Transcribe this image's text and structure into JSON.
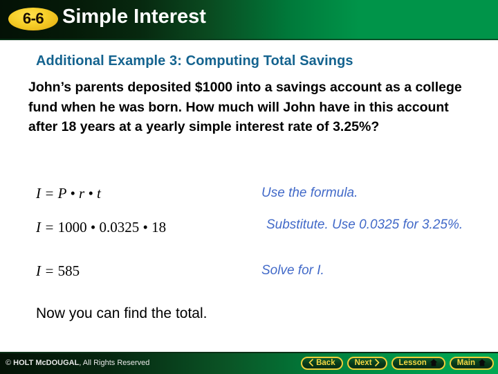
{
  "header": {
    "lesson_number": "6-6",
    "title": "Simple Interest",
    "background_left_color": "#041106",
    "background_right_color": "#009449",
    "badge_color": "#f7cf2a",
    "title_color": "#ffffff"
  },
  "slide": {
    "example_heading": "Additional Example 3: Computing Total Savings",
    "example_heading_color": "#14638f",
    "problem_text": "John’s parents deposited $1000 into a savings account as a college fund when he was born. How much will John have in this account after 18 years at a yearly simple interest rate of 3.25%?",
    "closing_text": "Now you can find the total.",
    "annotation_color": "#4169c8",
    "work_rows": [
      {
        "equation": "I = P • r • t",
        "annotation": "Use the formula."
      },
      {
        "equation_prefix": "I = ",
        "equation_numbers": "1000 • 0.0325 • 18",
        "annotation": "Substitute. Use 0.0325 for 3.25%."
      },
      {
        "equation_prefix": "I = ",
        "equation_numbers": "585",
        "annotation": "Solve for I."
      }
    ]
  },
  "footer": {
    "copyright_symbol": "© ",
    "copyright_brand": "HOLT McDOUGAL",
    "copyright_rest": ", All Rights Reserved",
    "buttons": [
      {
        "label": "Back",
        "icon": "chevron-left-icon"
      },
      {
        "label": "Next",
        "icon": "chevron-right-icon"
      },
      {
        "label": "Lesson",
        "icon": "home-icon"
      },
      {
        "label": "Main",
        "icon": "home-icon"
      }
    ],
    "button_border_color": "#f0cf3a",
    "button_text_color": "#f5d743"
  }
}
